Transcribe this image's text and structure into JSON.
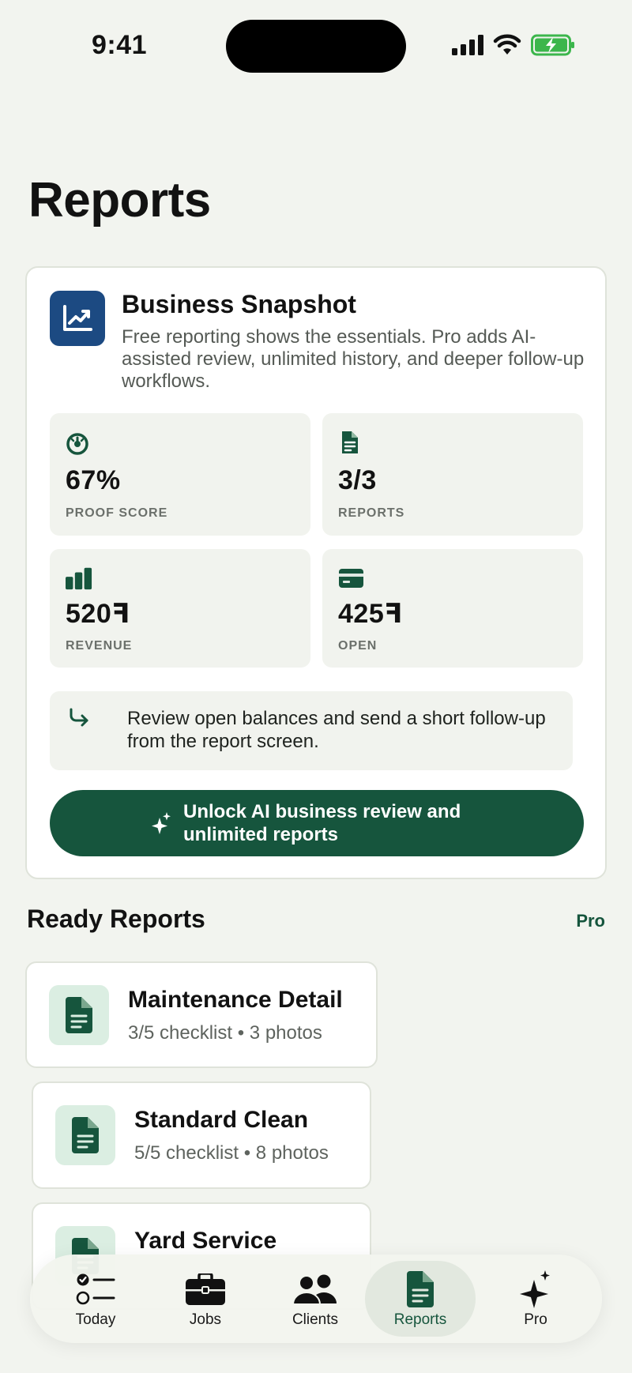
{
  "status_bar": {
    "time": "9:41"
  },
  "page": {
    "title": "Reports"
  },
  "snapshot": {
    "title": "Business Snapshot",
    "description": "Free reporting shows the essentials. Pro adds AI-assisted review, unlimited history, and deeper follow-up workflows.",
    "metrics": [
      {
        "icon": "gauge-icon",
        "value": "67%",
        "label": "PROOF SCORE"
      },
      {
        "icon": "document-icon",
        "value": "3/3",
        "label": "REPORTS"
      },
      {
        "icon": "bar-chart-icon",
        "value": "520ꟻ",
        "label": "REVENUE"
      },
      {
        "icon": "credit-card-icon",
        "value": "425ꟻ",
        "label": "OPEN"
      }
    ],
    "tip": "Review open balances and send a short follow-up from the report screen.",
    "unlock_label": "Unlock AI business review and unlimited reports"
  },
  "ready_reports": {
    "title": "Ready Reports",
    "badge": "Pro",
    "items": [
      {
        "title": "Maintenance Detail",
        "subtitle": "3/5 checklist • 3 photos"
      },
      {
        "title": "Standard Clean",
        "subtitle": "5/5 checklist • 8 photos"
      },
      {
        "title": "Yard Service",
        "subtitle": ""
      }
    ]
  },
  "tabs": [
    {
      "label": "Today",
      "icon": "checklist-icon"
    },
    {
      "label": "Jobs",
      "icon": "briefcase-icon"
    },
    {
      "label": "Clients",
      "icon": "people-icon"
    },
    {
      "label": "Reports",
      "icon": "document-icon",
      "active": true
    },
    {
      "label": "Pro",
      "icon": "sparkle-icon"
    }
  ],
  "colors": {
    "accent": "#16553d",
    "snapshot_icon_bg": "#1c4a82",
    "background": "#f2f4ef"
  }
}
